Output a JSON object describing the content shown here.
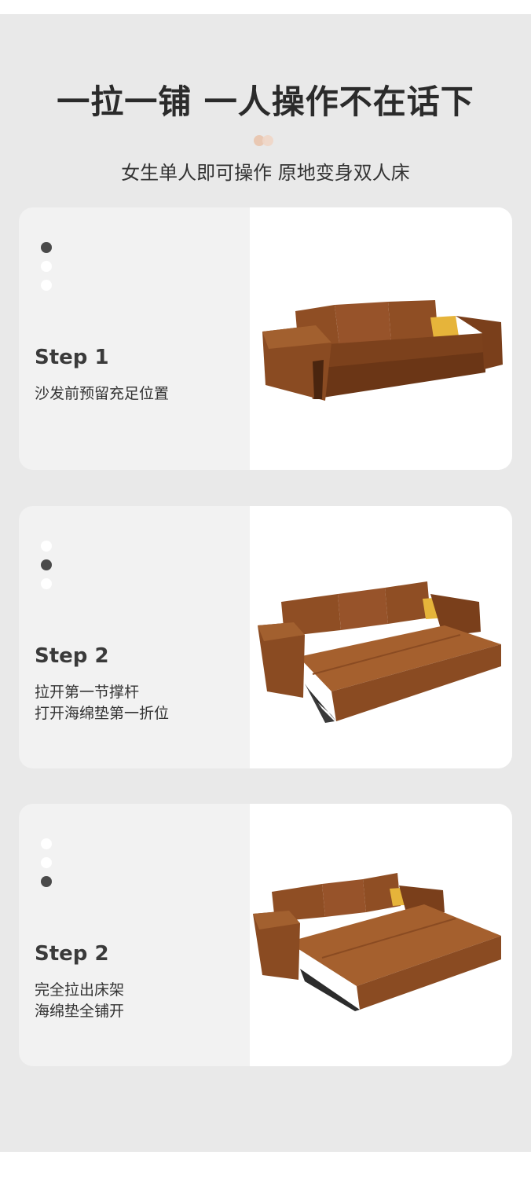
{
  "header": {
    "title": "一拉一铺 一人操作不在话下",
    "subtitle": "女生单人即可操作 原地变身双人床"
  },
  "colors": {
    "background": "#e9e9e9",
    "card_left": "#f2f2f2",
    "sofa_leather": "#8a4b22",
    "pillow": "#e6b43a",
    "active_dot": "#4a4a4a",
    "accent_dot": "#e9c8b3"
  },
  "steps": [
    {
      "title": "Step 1",
      "lines": [
        "沙发前预留充足位置"
      ],
      "active_dot": 0,
      "image": "sofa-closed"
    },
    {
      "title": "Step 2",
      "lines": [
        "拉开第一节撑杆",
        "打开海绵垫第一折位"
      ],
      "active_dot": 1,
      "image": "sofa-half-open"
    },
    {
      "title": "Step 2",
      "lines": [
        "完全拉出床架",
        "海绵垫全铺开"
      ],
      "active_dot": 2,
      "image": "sofa-bed-open"
    }
  ]
}
